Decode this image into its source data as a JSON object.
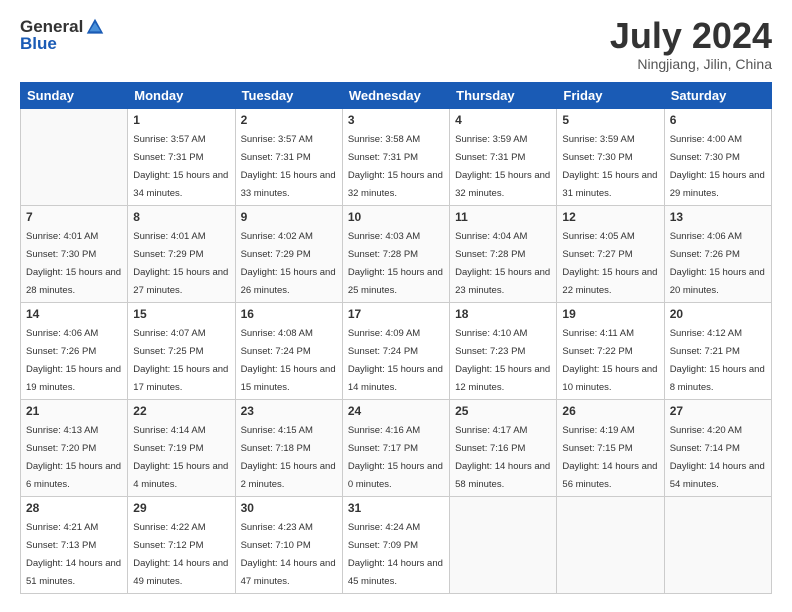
{
  "logo": {
    "general": "General",
    "blue": "Blue"
  },
  "title": {
    "month_year": "July 2024",
    "location": "Ningjiang, Jilin, China"
  },
  "weekdays": [
    "Sunday",
    "Monday",
    "Tuesday",
    "Wednesday",
    "Thursday",
    "Friday",
    "Saturday"
  ],
  "weeks": [
    [
      {
        "day": "",
        "sunrise": "",
        "sunset": "",
        "daylight": ""
      },
      {
        "day": "1",
        "sunrise": "Sunrise: 3:57 AM",
        "sunset": "Sunset: 7:31 PM",
        "daylight": "Daylight: 15 hours and 34 minutes."
      },
      {
        "day": "2",
        "sunrise": "Sunrise: 3:57 AM",
        "sunset": "Sunset: 7:31 PM",
        "daylight": "Daylight: 15 hours and 33 minutes."
      },
      {
        "day": "3",
        "sunrise": "Sunrise: 3:58 AM",
        "sunset": "Sunset: 7:31 PM",
        "daylight": "Daylight: 15 hours and 32 minutes."
      },
      {
        "day": "4",
        "sunrise": "Sunrise: 3:59 AM",
        "sunset": "Sunset: 7:31 PM",
        "daylight": "Daylight: 15 hours and 32 minutes."
      },
      {
        "day": "5",
        "sunrise": "Sunrise: 3:59 AM",
        "sunset": "Sunset: 7:30 PM",
        "daylight": "Daylight: 15 hours and 31 minutes."
      },
      {
        "day": "6",
        "sunrise": "Sunrise: 4:00 AM",
        "sunset": "Sunset: 7:30 PM",
        "daylight": "Daylight: 15 hours and 29 minutes."
      }
    ],
    [
      {
        "day": "7",
        "sunrise": "Sunrise: 4:01 AM",
        "sunset": "Sunset: 7:30 PM",
        "daylight": "Daylight: 15 hours and 28 minutes."
      },
      {
        "day": "8",
        "sunrise": "Sunrise: 4:01 AM",
        "sunset": "Sunset: 7:29 PM",
        "daylight": "Daylight: 15 hours and 27 minutes."
      },
      {
        "day": "9",
        "sunrise": "Sunrise: 4:02 AM",
        "sunset": "Sunset: 7:29 PM",
        "daylight": "Daylight: 15 hours and 26 minutes."
      },
      {
        "day": "10",
        "sunrise": "Sunrise: 4:03 AM",
        "sunset": "Sunset: 7:28 PM",
        "daylight": "Daylight: 15 hours and 25 minutes."
      },
      {
        "day": "11",
        "sunrise": "Sunrise: 4:04 AM",
        "sunset": "Sunset: 7:28 PM",
        "daylight": "Daylight: 15 hours and 23 minutes."
      },
      {
        "day": "12",
        "sunrise": "Sunrise: 4:05 AM",
        "sunset": "Sunset: 7:27 PM",
        "daylight": "Daylight: 15 hours and 22 minutes."
      },
      {
        "day": "13",
        "sunrise": "Sunrise: 4:06 AM",
        "sunset": "Sunset: 7:26 PM",
        "daylight": "Daylight: 15 hours and 20 minutes."
      }
    ],
    [
      {
        "day": "14",
        "sunrise": "Sunrise: 4:06 AM",
        "sunset": "Sunset: 7:26 PM",
        "daylight": "Daylight: 15 hours and 19 minutes."
      },
      {
        "day": "15",
        "sunrise": "Sunrise: 4:07 AM",
        "sunset": "Sunset: 7:25 PM",
        "daylight": "Daylight: 15 hours and 17 minutes."
      },
      {
        "day": "16",
        "sunrise": "Sunrise: 4:08 AM",
        "sunset": "Sunset: 7:24 PM",
        "daylight": "Daylight: 15 hours and 15 minutes."
      },
      {
        "day": "17",
        "sunrise": "Sunrise: 4:09 AM",
        "sunset": "Sunset: 7:24 PM",
        "daylight": "Daylight: 15 hours and 14 minutes."
      },
      {
        "day": "18",
        "sunrise": "Sunrise: 4:10 AM",
        "sunset": "Sunset: 7:23 PM",
        "daylight": "Daylight: 15 hours and 12 minutes."
      },
      {
        "day": "19",
        "sunrise": "Sunrise: 4:11 AM",
        "sunset": "Sunset: 7:22 PM",
        "daylight": "Daylight: 15 hours and 10 minutes."
      },
      {
        "day": "20",
        "sunrise": "Sunrise: 4:12 AM",
        "sunset": "Sunset: 7:21 PM",
        "daylight": "Daylight: 15 hours and 8 minutes."
      }
    ],
    [
      {
        "day": "21",
        "sunrise": "Sunrise: 4:13 AM",
        "sunset": "Sunset: 7:20 PM",
        "daylight": "Daylight: 15 hours and 6 minutes."
      },
      {
        "day": "22",
        "sunrise": "Sunrise: 4:14 AM",
        "sunset": "Sunset: 7:19 PM",
        "daylight": "Daylight: 15 hours and 4 minutes."
      },
      {
        "day": "23",
        "sunrise": "Sunrise: 4:15 AM",
        "sunset": "Sunset: 7:18 PM",
        "daylight": "Daylight: 15 hours and 2 minutes."
      },
      {
        "day": "24",
        "sunrise": "Sunrise: 4:16 AM",
        "sunset": "Sunset: 7:17 PM",
        "daylight": "Daylight: 15 hours and 0 minutes."
      },
      {
        "day": "25",
        "sunrise": "Sunrise: 4:17 AM",
        "sunset": "Sunset: 7:16 PM",
        "daylight": "Daylight: 14 hours and 58 minutes."
      },
      {
        "day": "26",
        "sunrise": "Sunrise: 4:19 AM",
        "sunset": "Sunset: 7:15 PM",
        "daylight": "Daylight: 14 hours and 56 minutes."
      },
      {
        "day": "27",
        "sunrise": "Sunrise: 4:20 AM",
        "sunset": "Sunset: 7:14 PM",
        "daylight": "Daylight: 14 hours and 54 minutes."
      }
    ],
    [
      {
        "day": "28",
        "sunrise": "Sunrise: 4:21 AM",
        "sunset": "Sunset: 7:13 PM",
        "daylight": "Daylight: 14 hours and 51 minutes."
      },
      {
        "day": "29",
        "sunrise": "Sunrise: 4:22 AM",
        "sunset": "Sunset: 7:12 PM",
        "daylight": "Daylight: 14 hours and 49 minutes."
      },
      {
        "day": "30",
        "sunrise": "Sunrise: 4:23 AM",
        "sunset": "Sunset: 7:10 PM",
        "daylight": "Daylight: 14 hours and 47 minutes."
      },
      {
        "day": "31",
        "sunrise": "Sunrise: 4:24 AM",
        "sunset": "Sunset: 7:09 PM",
        "daylight": "Daylight: 14 hours and 45 minutes."
      },
      {
        "day": "",
        "sunrise": "",
        "sunset": "",
        "daylight": ""
      },
      {
        "day": "",
        "sunrise": "",
        "sunset": "",
        "daylight": ""
      },
      {
        "day": "",
        "sunrise": "",
        "sunset": "",
        "daylight": ""
      }
    ]
  ]
}
